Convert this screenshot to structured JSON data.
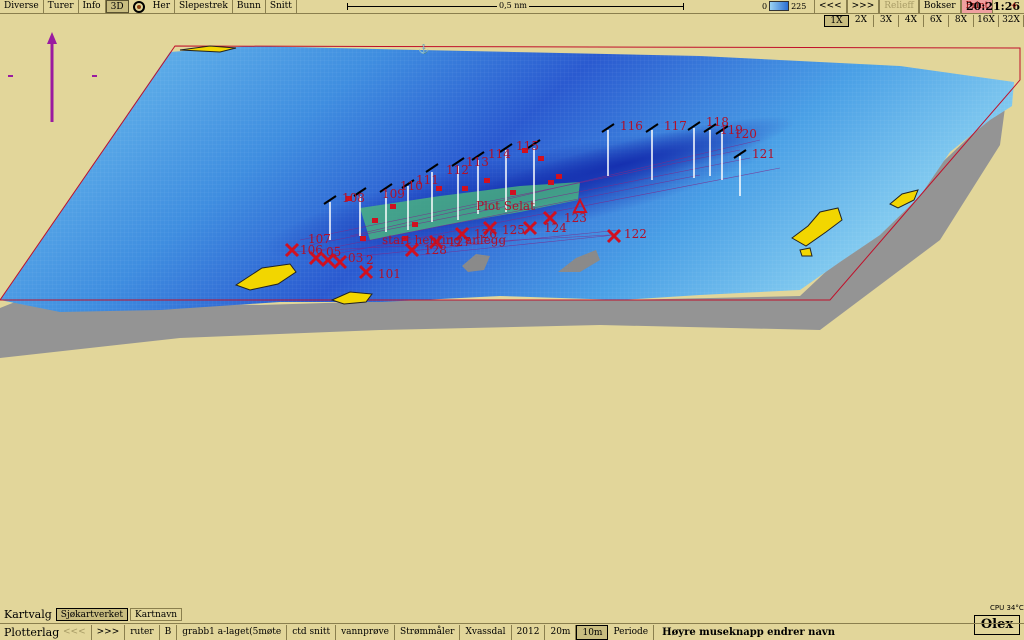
{
  "toolbar": {
    "diverse": "Diverse",
    "turer": "Turer",
    "info": "Info",
    "mode_3d": "3D",
    "her": "Her",
    "slepestrek": "Slepestrek",
    "bunn": "Bunn",
    "snitt": "Snitt",
    "scale_label": "0,5 nm",
    "depth_min": "0",
    "depth_max": "225",
    "prev": "<<<",
    "next": ">>>",
    "relieff": "Relieff",
    "bokser": "Bokser",
    "print": "Print",
    "clock": "20:21:26"
  },
  "zoom": [
    "1X",
    "2X",
    "3X",
    "4X",
    "6X",
    "8X",
    "16X",
    "32X"
  ],
  "zoom_active": "1X",
  "markers": {
    "flags": [
      "108",
      "109",
      "110",
      "111",
      "112",
      "113",
      "114",
      "115",
      "116",
      "117",
      "118",
      "119",
      "120",
      "121"
    ],
    "crosses": [
      "101",
      "105",
      "106",
      "107",
      "122",
      "123",
      "124",
      "125",
      "126",
      "127",
      "128",
      "103",
      "102"
    ],
    "texts": {
      "plot": "Plot Selat",
      "start": "start henting anlegg",
      "l106": "106",
      "l105": "05",
      "l103": "03",
      "l102": "2"
    }
  },
  "kartvalg": {
    "title": "Kartvalg",
    "sjokart": "Sjøkartverket",
    "kartnavn": "Kartnavn"
  },
  "plotterlag": {
    "title": "Plotterlag",
    "items": [
      "<<<",
      ">>>",
      "ruter",
      "B",
      "grabb1 a-laget(5møte",
      "ctd snitt",
      "vannprøve",
      "Strømmåler",
      "Xvassdal",
      "2012",
      "20m",
      "10m",
      "Periode"
    ],
    "hint": "Høyre museknapp endrer navn"
  },
  "status": {
    "cpu": "CPU 34°C",
    "brand": "Olex"
  },
  "colors": {
    "background": "#e2d69a",
    "accent": "#b0102a",
    "terrain_deep": "#1a3bbd",
    "terrain_shallow": "#8fd0f2",
    "land": "#f2d600"
  }
}
